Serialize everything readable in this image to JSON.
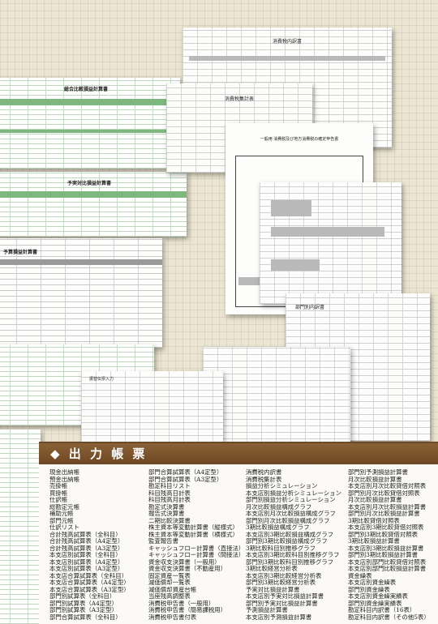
{
  "section": {
    "title": "◆ 出 力 帳 票"
  },
  "sheets": {
    "comparison_pl": "総合比較損益計算書",
    "budget_sales": "予実対比損益計算書",
    "budget_pl": "予算損益計算書",
    "consumption_tax_detail": "消費税内訳書",
    "consumption_tax_table": "消費税集計表",
    "consumption_tax_return": "一般用 消費税及び地方消費税の確定申告書",
    "department_table": "部門別内訳書",
    "journal": "振替伝票入力"
  },
  "columns": [
    [
      "現金出納帳",
      "預金出納帳",
      "売掛帳",
      "買掛帳",
      "仕訳帳",
      "総勘定元帳",
      "補助元帳",
      "部門元帳",
      "仕訳リスト",
      "合計残高試算表（全科目）",
      "合計残高試算表（A4定型）",
      "合計残高試算表（A3定型）",
      "本支店別試算表（全科目）",
      "本支店別試算表（A4定型）",
      "本支店別試算表（A3定型）",
      "本支店合算試算表（全科目）",
      "本支店合算試算表（A4定型）",
      "本支店合算試算表（A3定型）",
      "部門別試算表（全科目）",
      "部門別試算表（A4定型）",
      "部門別試算表（A3定型）",
      "部門合算試算表（全科目）"
    ],
    [
      "部門合算試算表（A4定型）",
      "部門合算試算表（A3定型）",
      "勘定科目リスト",
      "科目残高日計表",
      "科目残高月計表",
      "勘定式決算書",
      "報告式決算書",
      "二期比較決算書",
      "株主資本等変動計算書（縦様式）",
      "株主資本等変動計算書（横様式）",
      "監査報告書",
      "キャッシュフロー計算書（直接法）",
      "キャッシュフロー計算書（間接法）",
      "資金収支決算書（一般用）",
      "資金収支決算書（不動産用）",
      "固定資産一覧表",
      "減価償却一覧表",
      "減価償却資産台帳",
      "当座残高調整表",
      "消費税申告書（一般用）",
      "消費税申告書（簡易課税用）",
      "消費税申告書付表"
    ],
    [
      "消費税内訳書",
      "消費税集計表",
      "損益分析シミュレーション",
      "本支店別損益分析シミュレーション",
      "部門別損益分析シミュレーション",
      "月次比較損益構成グラフ",
      "本支店別月次比較損益構成グラフ",
      "部門別月次比較損益構成グラフ",
      "3期比較損益構成グラフ",
      "本支店別3期比較損益構成グラフ",
      "部門別3期比較損益構成グラフ",
      "3期比較科目別推移グラフ",
      "本支店別3期比較科目別推移グラフ",
      "部門別3期比較科目別推移グラフ",
      "3期比較経営分析表",
      "本支店別3期比較経営分析表",
      "部門別3期比較経営分析表",
      "予実対比損益計算書",
      "本支店別予実対比損益計算書",
      "部門別予実対比損益計算書",
      "予測損益計算書",
      "本支店別予測損益計算書"
    ],
    [
      "部門別予測損益計算書",
      "月次比較損益計算書",
      "本支店別月次比較貸借対照表",
      "部門別月次比較貸借対照表",
      "月次比較損益計算書",
      "本支店別月次比較損益計算書",
      "部門別月次比較損益計算書",
      "3期比較貸借対照表",
      "本支店別3期比較貸借対照表",
      "部門別3期比較貸借対照表",
      "3期比較損益計算書",
      "本支店別3期比較損益計算書",
      "部門別3期比較損益計算書",
      "本支店別部門比較貸借対照表",
      "本支店別部門比較損益計算書",
      "資金繰表",
      "本支店別資金繰表",
      "部門別資金繰表",
      "本支店別資金繰実績表",
      "部門別資金繰実績表",
      "勘定科目内訳書（16表）",
      "勘定科目内訳書（その他5表）"
    ]
  ]
}
